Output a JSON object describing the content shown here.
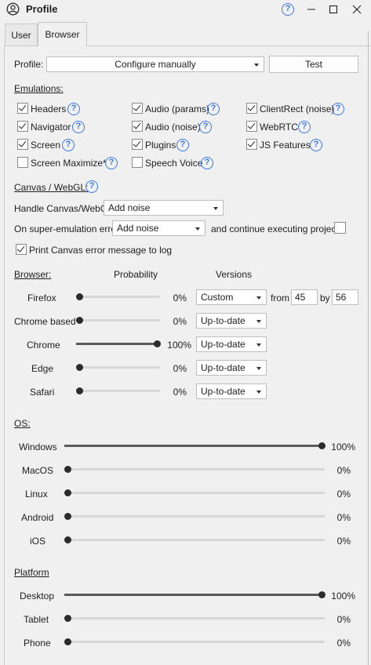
{
  "window": {
    "title": "Profile"
  },
  "tabs": [
    {
      "label": "User",
      "active": false
    },
    {
      "label": "Browser",
      "active": true
    }
  ],
  "profile": {
    "label": "Profile:",
    "value": "Configure manually",
    "test_button": "Test"
  },
  "emulations": {
    "heading": "Emulations:",
    "items": [
      {
        "label": "Headers",
        "checked": true
      },
      {
        "label": "Audio (params)",
        "checked": true
      },
      {
        "label": "ClientRect (noise)",
        "checked": true
      },
      {
        "label": "Navigator",
        "checked": true
      },
      {
        "label": "Audio (noise)",
        "checked": true
      },
      {
        "label": "WebRTC",
        "checked": true
      },
      {
        "label": "Screen",
        "checked": true
      },
      {
        "label": "Plugins",
        "checked": true
      },
      {
        "label": "JS Features",
        "checked": true
      },
      {
        "label": "Screen Maximize*",
        "checked": false
      },
      {
        "label": "Speech Voice",
        "checked": false
      }
    ]
  },
  "canvas": {
    "heading": "Canvas / WebGL:",
    "handle_label": "Handle Canvas/WebGL",
    "handle_value": "Add noise",
    "error_label": "On super-emulation error",
    "error_value": "Add noise",
    "continue_label": "and continue executing project",
    "continue_checked": false,
    "print_label": "Print Canvas error message to log",
    "print_checked": true
  },
  "browser": {
    "heading": "Browser:",
    "col_probability": "Probability",
    "col_versions": "Versions",
    "from_label": "from",
    "by_label": "by",
    "from_value": "45",
    "by_value": "56",
    "rows": [
      {
        "name": "Firefox",
        "percent": "0%",
        "level": 0,
        "version": "Custom"
      },
      {
        "name": "Chrome based",
        "percent": "0%",
        "level": 0,
        "version": "Up-to-date"
      },
      {
        "name": "Chrome",
        "percent": "100%",
        "level": 1,
        "version": "Up-to-date"
      },
      {
        "name": "Edge",
        "percent": "0%",
        "level": 0,
        "version": "Up-to-date"
      },
      {
        "name": "Safari",
        "percent": "0%",
        "level": 0,
        "version": "Up-to-date"
      }
    ]
  },
  "os": {
    "heading": "OS:",
    "rows": [
      {
        "name": "Windows",
        "percent": "100%",
        "level": 1
      },
      {
        "name": "MacOS",
        "percent": "0%",
        "level": 0
      },
      {
        "name": "Linux",
        "percent": "0%",
        "level": 0
      },
      {
        "name": "Android",
        "percent": "0%",
        "level": 0
      },
      {
        "name": "iOS",
        "percent": "0%",
        "level": 0
      }
    ]
  },
  "platform": {
    "heading": "Platform",
    "rows": [
      {
        "name": "Desktop",
        "percent": "100%",
        "level": 1
      },
      {
        "name": "Tablet",
        "percent": "0%",
        "level": 0
      },
      {
        "name": "Phone",
        "percent": "0%",
        "level": 0
      }
    ]
  },
  "icons": {
    "help": "?",
    "help_icon_name": "help-icon",
    "profile_icon": "user-circle-icon"
  },
  "colors": {
    "accent": "#3b78e7",
    "background": "#f0f0f0"
  }
}
